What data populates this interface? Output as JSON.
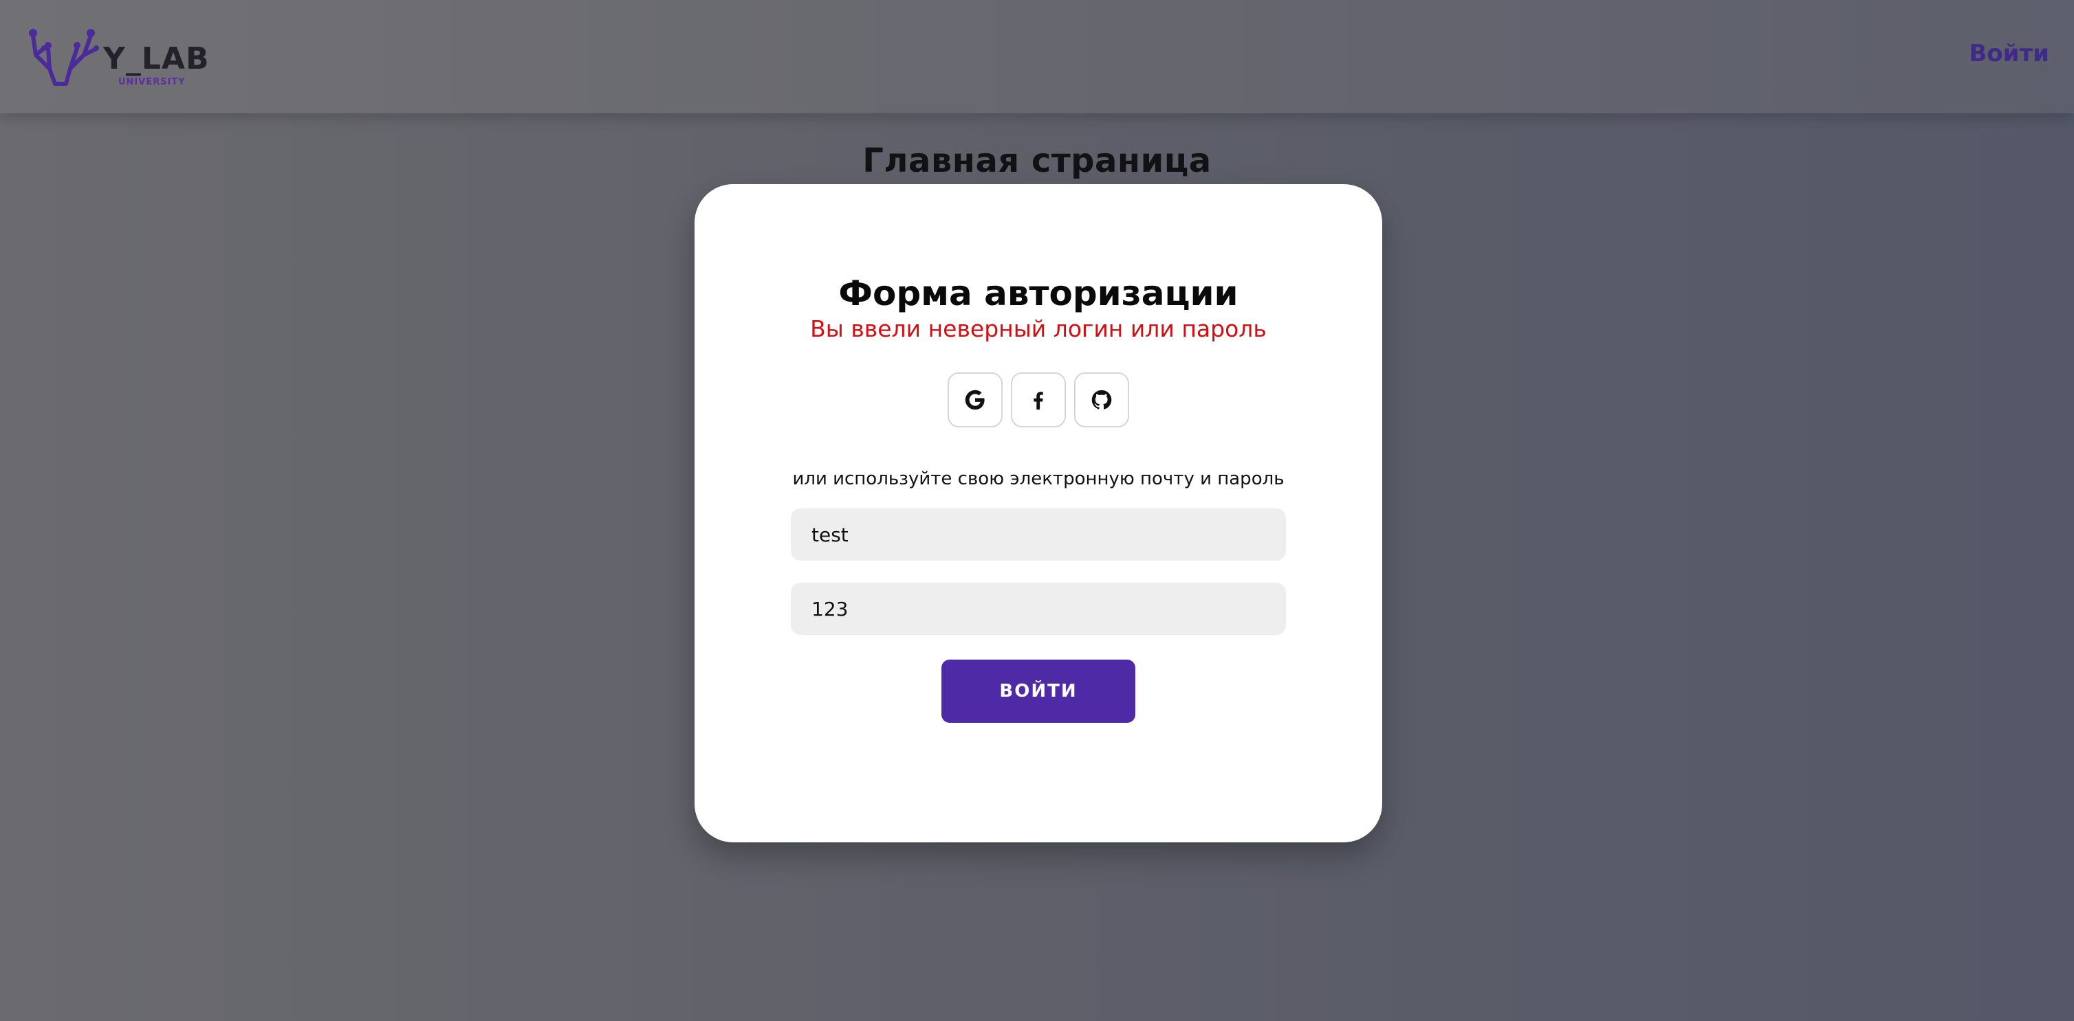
{
  "header": {
    "logo_text": "Y_LAB",
    "logo_sub": "UNIVERSITY",
    "login_link": "Войти",
    "accent_color": "#3f2a87"
  },
  "page": {
    "title": "Главная страница"
  },
  "auth_form": {
    "title": "Форма авторизации",
    "error": "Вы ввели неверный логин или пароль",
    "error_color": "#d40f12",
    "socials": [
      {
        "name": "google",
        "icon": "google-icon"
      },
      {
        "name": "facebook",
        "icon": "facebook-icon"
      },
      {
        "name": "github",
        "icon": "github-icon"
      }
    ],
    "hint": "или используйте свою электронную почту и пароль",
    "login_value": "test",
    "password_value": "123",
    "submit_label": "ВОЙТИ",
    "submit_color": "#4f2aa6"
  }
}
